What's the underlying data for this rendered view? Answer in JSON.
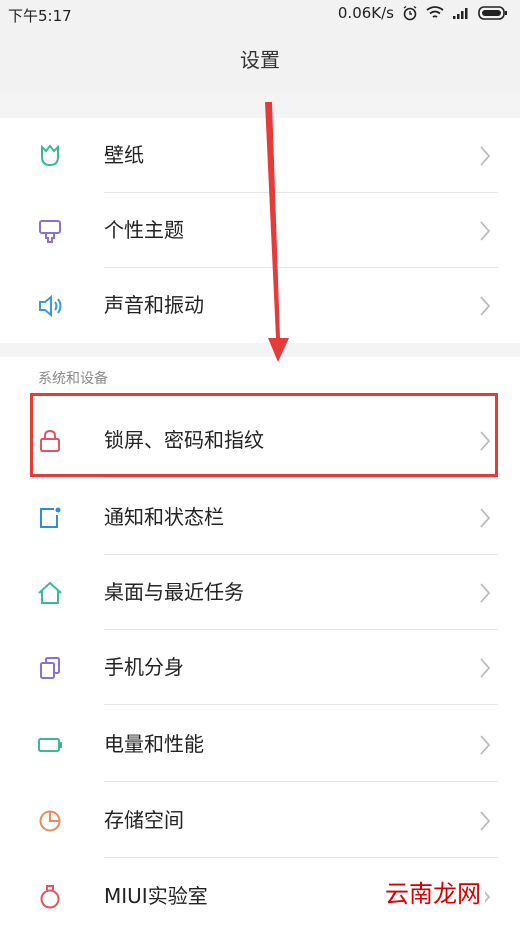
{
  "status_bar": {
    "time": "下午5:17",
    "speed": "0.06K/s"
  },
  "header": {
    "title": "设置"
  },
  "sections": {
    "personal": [
      {
        "label": "壁纸",
        "icon": "wallpaper-icon",
        "color": "#3bb89a"
      },
      {
        "label": "个性主题",
        "icon": "theme-brush-icon",
        "color": "#8a6fd6"
      },
      {
        "label": "声音和振动",
        "icon": "speaker-icon",
        "color": "#3a9ad9"
      }
    ],
    "system_label": "系统和设备",
    "system": [
      {
        "label": "锁屏、密码和指纹",
        "icon": "lock-icon",
        "color": "#e0555f"
      },
      {
        "label": "通知和状态栏",
        "icon": "notification-icon",
        "color": "#2a8fd6"
      },
      {
        "label": "桌面与最近任务",
        "icon": "home-icon",
        "color": "#3bb89a"
      },
      {
        "label": "手机分身",
        "icon": "dual-app-icon",
        "color": "#8a6fd6"
      },
      {
        "label": "电量和性能",
        "icon": "battery-icon",
        "color": "#3bb89a"
      },
      {
        "label": "存储空间",
        "icon": "storage-pie-icon",
        "color": "#f0885a"
      },
      {
        "label": "MIUI实验室",
        "icon": "lab-flask-icon",
        "color": "#e0555f"
      }
    ]
  },
  "watermark": "云南龙网",
  "highlight_color": "#e53b3b"
}
